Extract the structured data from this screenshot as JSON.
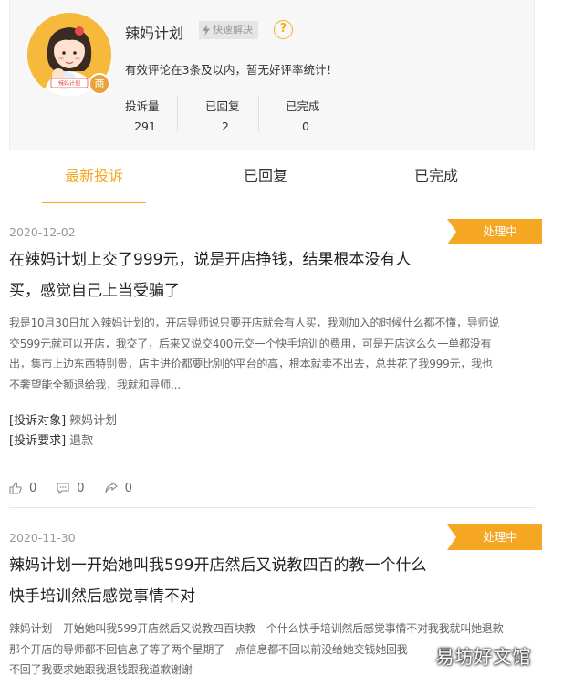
{
  "profile": {
    "name": "辣妈计划",
    "quick_badge": "快速解决",
    "help_glyph": "?",
    "avatar_logo_text": "辣妈计划",
    "merchant_badge": "商",
    "notice": "有效评论在3条及以内，暂无好评率统计！",
    "stats": [
      {
        "label": "投诉量",
        "value": "291"
      },
      {
        "label": "已回复",
        "value": "2"
      },
      {
        "label": "已完成",
        "value": "0"
      }
    ]
  },
  "tabs": [
    {
      "label": "最新投诉",
      "active": true
    },
    {
      "label": "已回复",
      "active": false
    },
    {
      "label": "已完成",
      "active": false
    }
  ],
  "complaints": [
    {
      "date": "2020-12-02",
      "status": "处理中",
      "title_lines": [
        "在辣妈计划上交了999元，说是开店挣钱，结果根本没有人",
        "买，感觉自己上当受骗了"
      ],
      "desc_lines": [
        "我是10月30日加入辣妈计划的，开店导师说只要开店就会有人买，我刚加入的时候什么都不懂，导师说",
        "交599元就可以开店，我交了，后来又说交400元交一个快手培训的费用，可是开店这么久一单都没有",
        "出，集市上边东西特别贵，店主进价都要比别的平台的高，根本就卖不出去，总共花了我999元，我也",
        "不奢望能全额退给我，我就和导师..."
      ],
      "target_label": "[投诉对象]",
      "target_value": "辣妈计划",
      "request_label": "[投诉要求]",
      "request_value": "退款",
      "likes": "0",
      "comments": "0",
      "shares": "0"
    },
    {
      "date": "2020-11-30",
      "status": "处理中",
      "title_lines": [
        "辣妈计划一开始她叫我599开店然后又说教四百的教一个什么",
        "快手培训然后感觉事情不对"
      ],
      "desc_lines": [
        "辣妈计划一开始她叫我599开店然后又说教四百块教一个什么快手培训然后感觉事情不对我我就叫她退款",
        "那个开店的导师都不回信息了等了两个星期了一点信息都不回以前没给她交钱她回我",
        "不回了我要求她跟我退钱跟我道歉谢谢"
      ]
    }
  ],
  "watermark": "易坊好文馆",
  "colors": {
    "accent": "#f5a623",
    "avatar_bg": "#f6b93b"
  }
}
